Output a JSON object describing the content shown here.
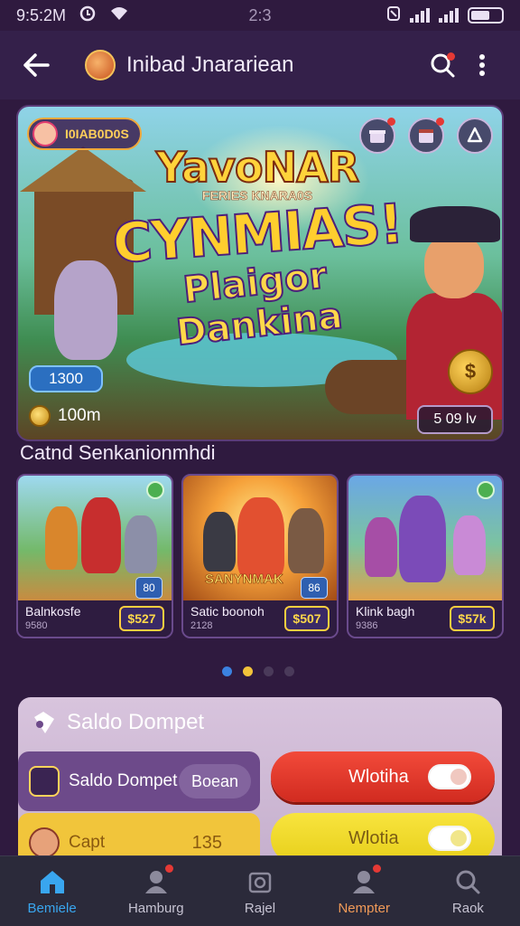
{
  "status": {
    "time": "9:5:2M",
    "center": "2:3"
  },
  "app_bar": {
    "title": "Inibad Jnarariean"
  },
  "hero": {
    "chip": "I0IAB0D0S",
    "title_line1": "YavoNAR",
    "title_line2": "FERIES KNARA0S",
    "title_line3": "CYNMIAS!",
    "title_line4": "Plaigor Dankina",
    "coin_pill": "1300",
    "timer": "100m",
    "price": "5 09 lv"
  },
  "section": {
    "title": "Catnd Senkanionmhdi"
  },
  "cards": [
    {
      "name": "Balnkosfe",
      "sub": "9580",
      "price": "$527",
      "small": "80"
    },
    {
      "name": "Satic boonoh",
      "sub": "2128",
      "price": "$507",
      "small": "86",
      "banner": "SANYNMAK"
    },
    {
      "name": "Klink bagh",
      "sub": "9386",
      "price": "$57k",
      "small": ""
    }
  ],
  "pager": {
    "active_colors": [
      "#3b82e0",
      "#f2c33a",
      "#4a3a5a",
      "#4a3a5a"
    ]
  },
  "wallet": {
    "title": "Saldo Dompet",
    "row1_label": "Saldo Dompet",
    "row1_pill": "Boean",
    "row2_label": "Capt",
    "row2_value": "135",
    "btn_red": "Wlotiha",
    "btn_yellow": "Wlotia"
  },
  "nav": [
    {
      "label": "Bemiele",
      "icon": "home-icon"
    },
    {
      "label": "Hamburg",
      "icon": "user-icon"
    },
    {
      "label": "Rajel",
      "icon": "camera-icon"
    },
    {
      "label": "Nempter",
      "icon": "profile-icon"
    },
    {
      "label": "Raok",
      "icon": "search-icon"
    }
  ],
  "colors": {
    "background": "#2f1a3f",
    "accent": "#39a6ef",
    "gold": "#ffd33b",
    "red": "#e53935"
  }
}
